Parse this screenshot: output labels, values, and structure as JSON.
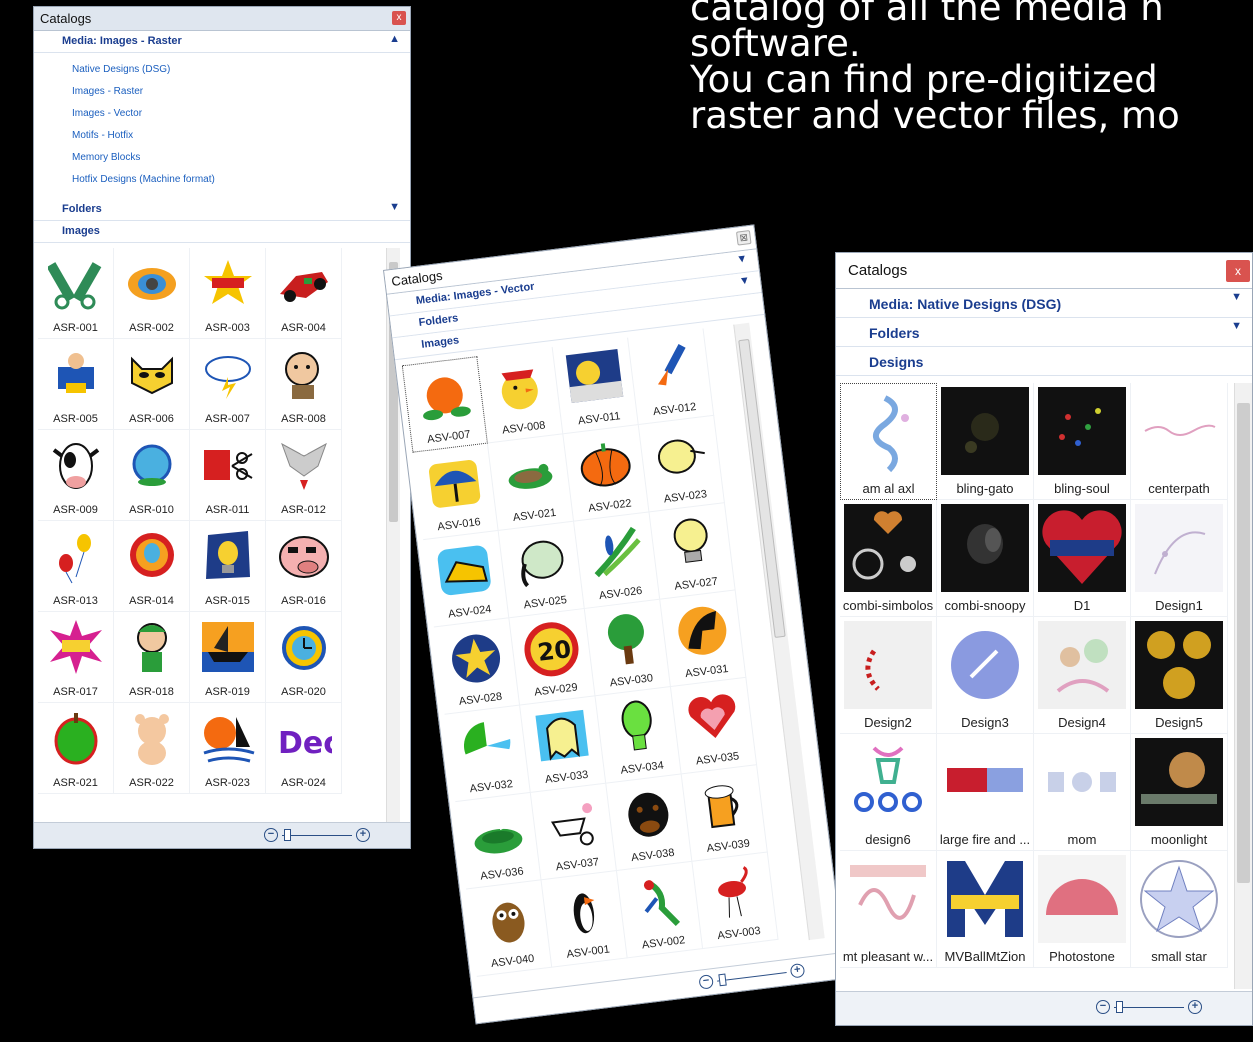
{
  "headline": {
    "line1": "catalog of all the media h",
    "line2": "software.",
    "line3": "You can find pre-digitized",
    "line4": "raster and vector files, mo"
  },
  "panel_raster": {
    "title": "Catalogs",
    "close": "x",
    "media_header": "Media: Images - Raster",
    "media_items": [
      "Native Designs (DSG)",
      "Images - Raster",
      "Images - Vector",
      "Motifs - Hotfix",
      "Memory Blocks",
      "Hotfix Designs (Machine format)"
    ],
    "folders": "Folders",
    "images": "Images",
    "thumbs": [
      "ASR-001",
      "ASR-002",
      "ASR-003",
      "ASR-004",
      "ASR-005",
      "ASR-006",
      "ASR-007",
      "ASR-008",
      "ASR-009",
      "ASR-010",
      "ASR-011",
      "ASR-012",
      "ASR-013",
      "ASR-014",
      "ASR-015",
      "ASR-016",
      "ASR-017",
      "ASR-018",
      "ASR-019",
      "ASR-020",
      "ASR-021",
      "ASR-022",
      "ASR-023",
      "ASR-024"
    ],
    "zoom_minus": "−",
    "zoom_plus": "+"
  },
  "panel_vector": {
    "title": "Catalogs",
    "media_header": "Media: Images - Vector",
    "folders": "Folders",
    "images": "Images",
    "thumbs": [
      "ASV-007",
      "ASV-008",
      "ASV-011",
      "ASV-012",
      "ASV-016",
      "ASV-021",
      "ASV-022",
      "ASV-023",
      "ASV-024",
      "ASV-025",
      "ASV-026",
      "ASV-027",
      "ASV-028",
      "ASV-029",
      "ASV-030",
      "ASV-031",
      "ASV-032",
      "ASV-033",
      "ASV-034",
      "ASV-035",
      "ASV-036",
      "ASV-037",
      "ASV-038",
      "ASV-039",
      "ASV-040",
      "ASV-001",
      "ASV-002",
      "ASV-003"
    ],
    "zoom_minus": "−",
    "zoom_plus": "+"
  },
  "panel_dsg": {
    "title": "Catalogs",
    "close": "x",
    "media_header": "Media: Native Designs (DSG)",
    "folders": "Folders",
    "designs": "Designs",
    "thumbs": [
      "am al axl",
      "bling-gato",
      "bling-soul",
      "centerpath",
      "combi-simbolos",
      "combi-snoopy",
      "D1",
      "Design1",
      "Design2",
      "Design3",
      "Design4",
      "Design5",
      "design6",
      "large fire and ...",
      "mom",
      "moonlight",
      "mt pleasant w...",
      "MVBallMtZion",
      "Photostone",
      "small star"
    ],
    "zoom_minus": "−",
    "zoom_plus": "+"
  },
  "colors": {
    "accent": "#1a3d8f",
    "link": "#1b5fbf",
    "close": "#d9534f",
    "titlebar": "#dfe6ef"
  }
}
